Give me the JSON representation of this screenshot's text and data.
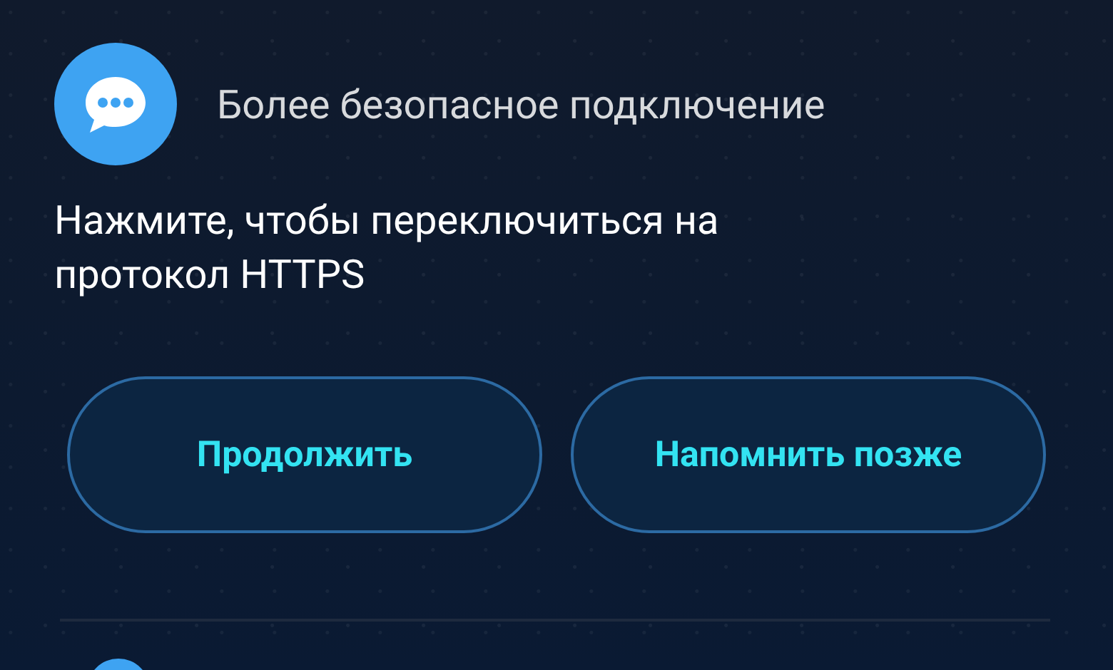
{
  "notification": {
    "title": "Более безопасное подключение",
    "message": "Нажмите, чтобы переключиться на протокол HTTPS"
  },
  "buttons": [
    {
      "label": "Продолжить"
    },
    {
      "label": "Напомнить позже"
    }
  ]
}
